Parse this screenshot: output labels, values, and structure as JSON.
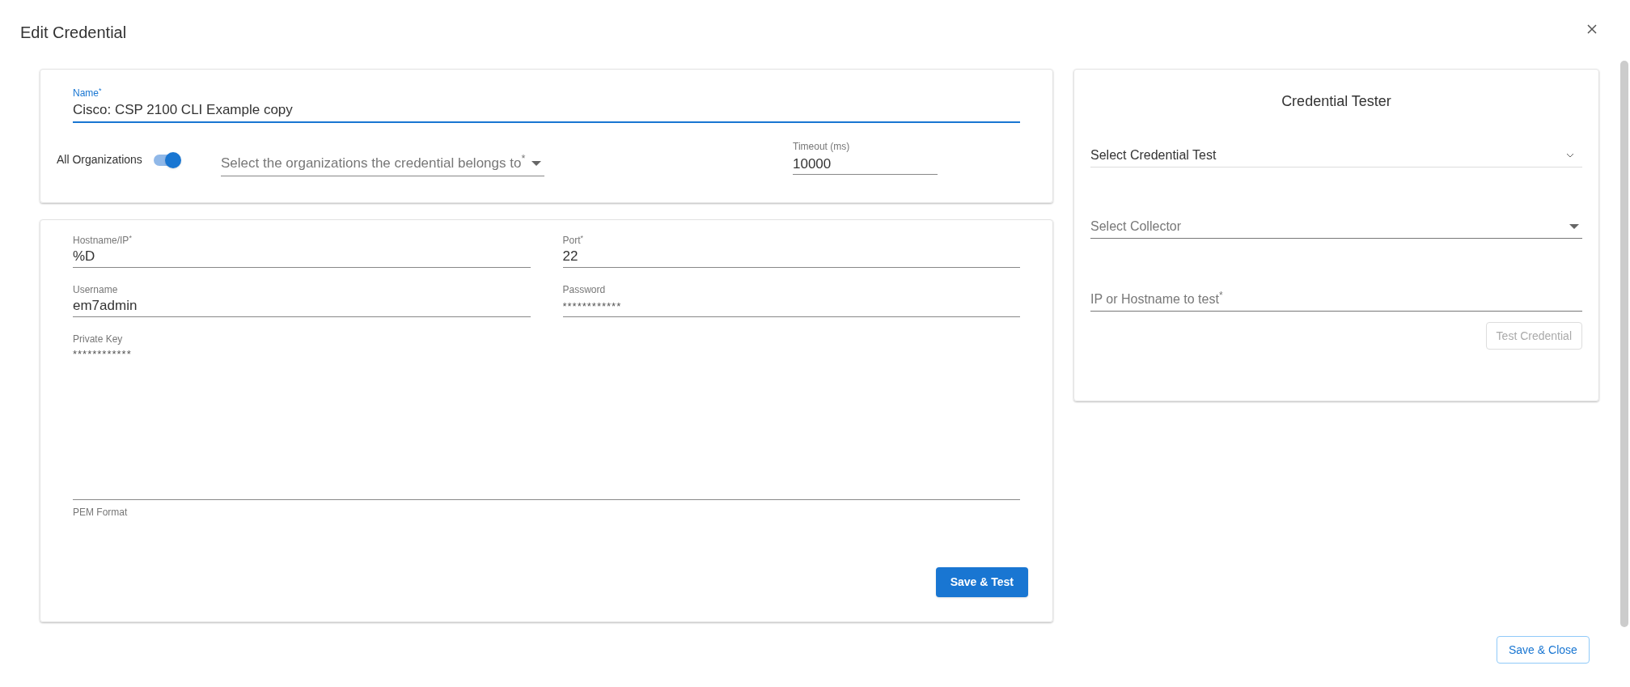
{
  "dialog": {
    "title": "Edit Credential"
  },
  "credential_card": {
    "name_field": {
      "label": "Name$^{*}$",
      "value": "Cisco: CSP 2100 CLI Example copy",
      "focused": true
    },
    "all_organizations": {
      "label": "All Organizations",
      "on": true
    },
    "organizations_select": {
      "placeholder": "Select the organizations the credential belongs to$^{*}$"
    },
    "timeout_field": {
      "label": "Timeout (ms)",
      "value": "10000"
    }
  },
  "connection_card": {
    "fields": [
      {
        "label": "Hostname/IP$^{*}$",
        "value": "%D",
        "kind": "text"
      },
      {
        "label": "Port$^{*}$",
        "value": "22",
        "kind": "text"
      },
      {
        "label": "Username",
        "value": "em7admin",
        "kind": "text"
      },
      {
        "label": "Password",
        "value": "************",
        "kind": "password"
      },
      {
        "label": "Private Key",
        "value": "************",
        "kind": "textarea",
        "helper": "PEM Format"
      }
    ],
    "button": "Save & Test"
  },
  "tester_card": {
    "title": "Credential Tester",
    "test_select": {
      "placeholder": "Select Credential Test"
    },
    "collector_select": {
      "placeholder": "Select Collector"
    },
    "ip_field": {
      "placeholder": "IP or Hostname to test$^{*}$"
    },
    "button": {
      "label": "Test Credential",
      "disabled": true
    }
  },
  "footer": {
    "button": "Save & Close"
  }
}
